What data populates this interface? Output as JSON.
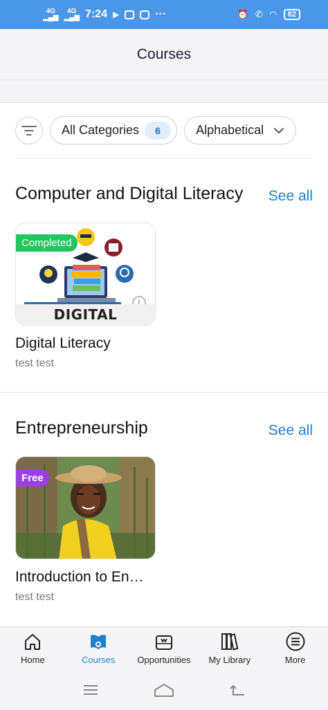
{
  "status_bar": {
    "time": "7:24",
    "net1": "4G",
    "net2": "4G",
    "battery": "82"
  },
  "header": {
    "title": "Courses"
  },
  "filters": {
    "category_label": "All Categories",
    "category_count": "6",
    "sort_label": "Alphabetical"
  },
  "sections": [
    {
      "title": "Computer and Digital Literacy",
      "see_all": "See all",
      "course": {
        "badge": "Completed",
        "image_caption": "DIGITAL LITERACY",
        "title": "Digital Literacy",
        "author": "test test"
      }
    },
    {
      "title": "Entrepreneurship",
      "see_all": "See all",
      "course": {
        "badge": "Free",
        "title": "Introduction to En…",
        "author": "test test"
      }
    }
  ],
  "bottom_nav": {
    "items": [
      {
        "label": "Home",
        "icon": "home-icon"
      },
      {
        "label": "Courses",
        "icon": "courses-icon"
      },
      {
        "label": "Opportunities",
        "icon": "briefcase-icon"
      },
      {
        "label": "My Library",
        "icon": "library-icon"
      },
      {
        "label": "More",
        "icon": "menu-icon"
      }
    ],
    "active": "Courses"
  },
  "colors": {
    "accent": "#1f7fd1",
    "status_bar": "#4a97ea",
    "completed": "#22c55e",
    "free": "#9b3fe0"
  }
}
